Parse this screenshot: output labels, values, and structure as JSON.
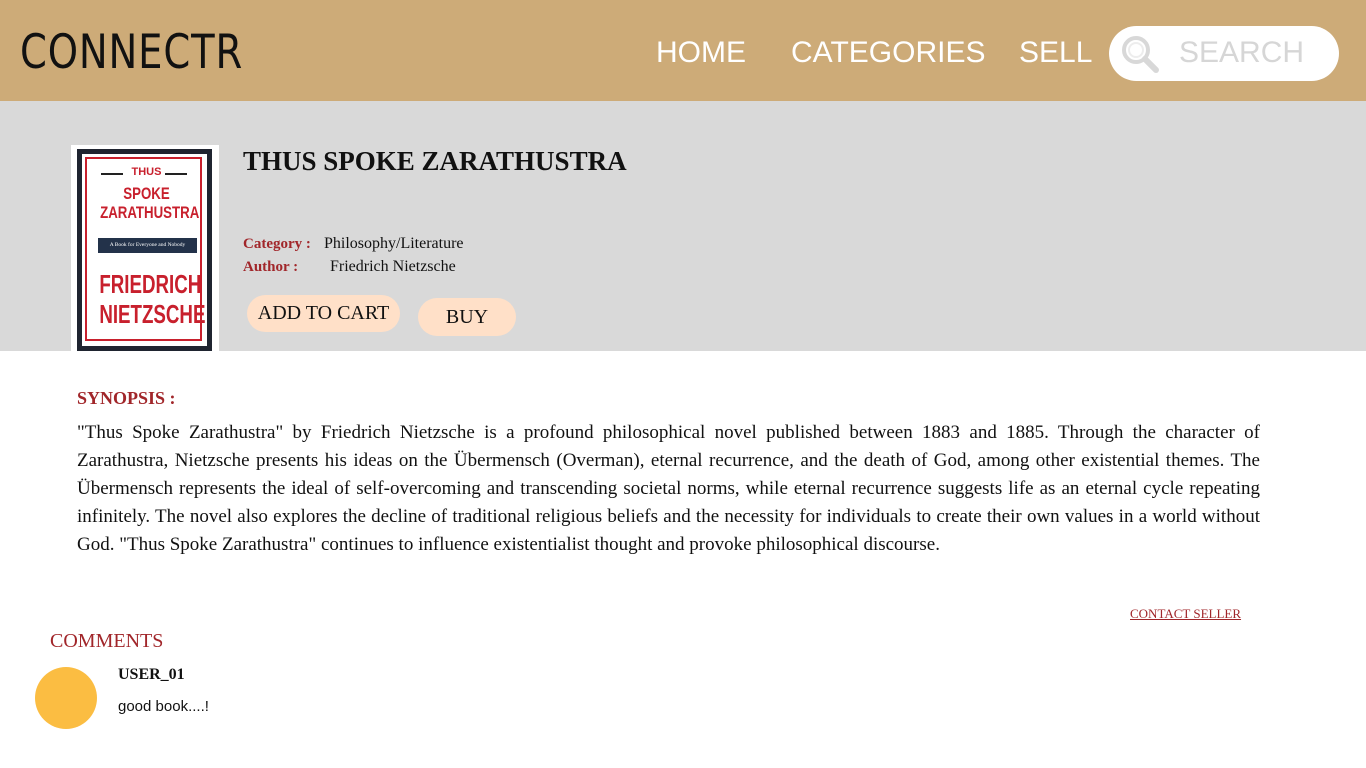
{
  "header": {
    "logo": "CONNECTR",
    "nav": {
      "home": "HOME",
      "categories": "CATEGORIES",
      "sell": "SELL"
    },
    "search": {
      "placeholder": "SEARCH",
      "icon": "search-icon"
    }
  },
  "book": {
    "cover": {
      "title_top": "THUS",
      "title_main": "SPOKE ZARATHUSTRA",
      "subtitle": "A Book for Everyone and Nobody",
      "author": "FRIEDRICH NIETZSCHE"
    },
    "title": "THUS SPOKE ZARATHUSTRA",
    "category_label": "Category  :",
    "category": "Philosophy/Literature",
    "author_label": "Author    :",
    "author": "Friedrich Nietzsche",
    "add_to_cart_label": "ADD TO CART",
    "buy_label": "BUY"
  },
  "synopsis": {
    "label": "SYNOPSIS :",
    "text": "\"Thus Spoke Zarathustra\" by Friedrich Nietzsche is a profound philosophical novel published between 1883 and 1885. Through the character of Zarathustra, Nietzsche presents his ideas on the Übermensch (Overman), eternal recurrence, and the death of God, among other existential themes. The Übermensch represents the ideal of self-overcoming and transcending societal norms, while eternal recurrence suggests life as an eternal cycle repeating infinitely. The novel also explores the decline of traditional religious beliefs and the necessity for individuals to create their own values in a world without God. \"Thus Spoke Zarathustra\" continues to influence existentialist thought and provoke philosophical discourse."
  },
  "contact_seller_label": "CONTACT SELLER",
  "comments": {
    "label": "COMMENTS",
    "items": [
      {
        "user": "USER_01",
        "text": "good book....!"
      }
    ]
  },
  "colors": {
    "header_bg": "#cdab78",
    "band_bg": "#d9d9d9",
    "accent_red": "#a1262a",
    "button_bg": "#ffe0c8",
    "avatar": "#fbbd42"
  }
}
